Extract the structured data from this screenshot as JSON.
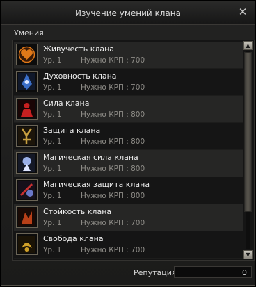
{
  "window": {
    "title": "Изучение умений клана",
    "close_glyph": "✕",
    "section_label": "Умения"
  },
  "skills": [
    {
      "name": "Живучесть клана",
      "level": "Ур. 1",
      "cost": "Нужно КРП : 700",
      "icon": "heart-icon",
      "accent": "#e07818"
    },
    {
      "name": "Духовность клана",
      "level": "Ур. 1",
      "cost": "Нужно КРП : 700",
      "icon": "spirit-icon",
      "accent": "#3a6ec8"
    },
    {
      "name": "Сила клана",
      "level": "Ур. 1",
      "cost": "Нужно КРП : 800",
      "icon": "strength-icon",
      "accent": "#c82020"
    },
    {
      "name": "Защита клана",
      "level": "Ур. 1",
      "cost": "Нужно КРП : 800",
      "icon": "defense-icon",
      "accent": "#c8a040"
    },
    {
      "name": "Магическая сила клана",
      "level": "Ур. 1",
      "cost": "Нужно КРП : 800",
      "icon": "magic-power-icon",
      "accent": "#9ab0e8"
    },
    {
      "name": "Магическая защита клана",
      "level": "Ур. 1",
      "cost": "Нужно КРП : 800",
      "icon": "magic-defense-icon",
      "accent": "#c83030"
    },
    {
      "name": "Стойкость клана",
      "level": "Ур. 1",
      "cost": "Нужно КРП : 700",
      "icon": "fortitude-icon",
      "accent": "#b84018"
    },
    {
      "name": "Свобода клана",
      "level": "Ур. 1",
      "cost": "Нужно КРП : 700",
      "icon": "freedom-icon",
      "accent": "#d0a028"
    }
  ],
  "scroll": {
    "up_glyph": "▲",
    "down_glyph": "▼"
  },
  "footer": {
    "reputation_label": "Репутация",
    "reputation_value": "0"
  }
}
